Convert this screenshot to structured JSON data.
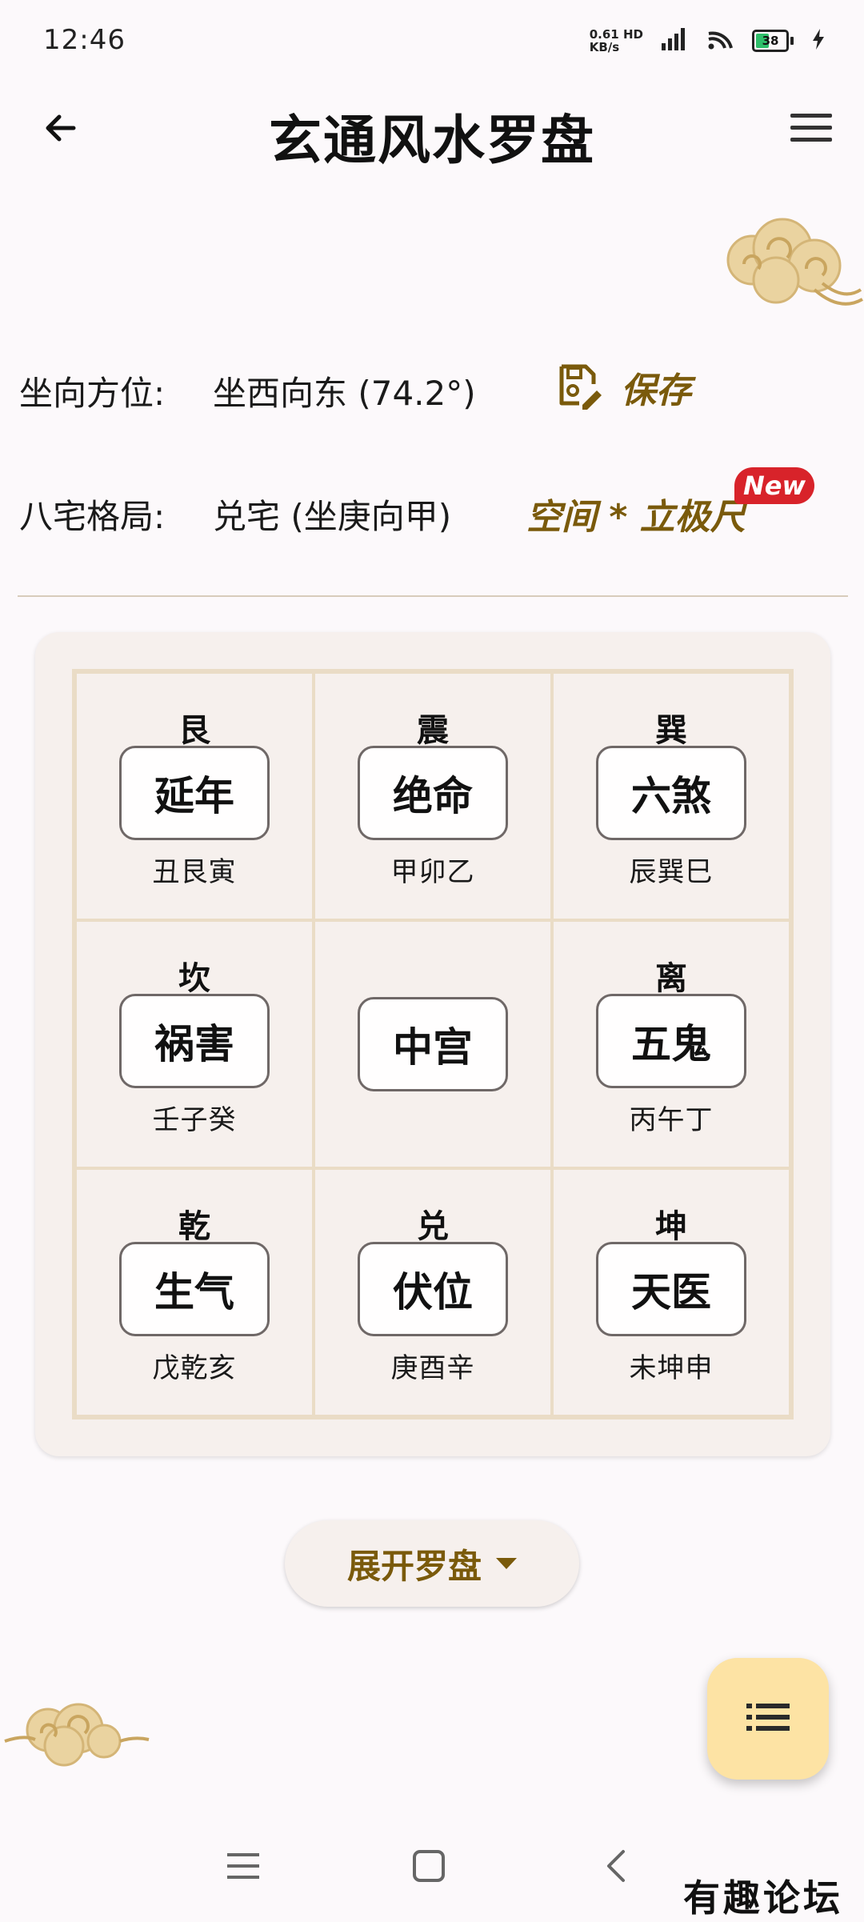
{
  "status_bar": {
    "time": "12:46",
    "net_speed_value": "0.61",
    "net_speed_unit": "KB/s",
    "net_type": "HD",
    "battery_level": "38",
    "icons": [
      "signal-icon",
      "wifi-icon",
      "battery-icon",
      "charging-icon"
    ]
  },
  "app_bar": {
    "title": "玄通风水罗盘",
    "back_icon": "arrow-left-icon",
    "menu_icon": "hamburger-menu-icon"
  },
  "orientation_row": {
    "label": "坐向方位:",
    "value": "坐西向东 (74.2°)",
    "save_label": "保存",
    "save_icon": "save-edit-icon"
  },
  "house_row": {
    "label": "八宅格局:",
    "value": "兑宅 (坐庚向甲)",
    "link_label": "空间 * 立极尺",
    "badge": "New"
  },
  "grid": {
    "cells": [
      {
        "trigram": "艮",
        "star": "延年",
        "mountains": "丑艮寅"
      },
      {
        "trigram": "震",
        "star": "绝命",
        "mountains": "甲卯乙"
      },
      {
        "trigram": "巽",
        "star": "六煞",
        "mountains": "辰巽巳"
      },
      {
        "trigram": "坎",
        "star": "祸害",
        "mountains": "壬子癸"
      },
      {
        "trigram": "",
        "star": "中宫",
        "mountains": ""
      },
      {
        "trigram": "离",
        "star": "五鬼",
        "mountains": "丙午丁"
      },
      {
        "trigram": "乾",
        "star": "生气",
        "mountains": "戊乾亥"
      },
      {
        "trigram": "兑",
        "star": "伏位",
        "mountains": "庚酉辛"
      },
      {
        "trigram": "坤",
        "star": "天医",
        "mountains": "未坤申"
      }
    ]
  },
  "expand_button": {
    "label": "展开罗盘",
    "icon": "caret-down-icon"
  },
  "fab": {
    "icon": "list-icon"
  },
  "nav_bar": {
    "items": [
      "recents-icon",
      "home-icon",
      "back-icon"
    ]
  },
  "watermark": "有趣论坛",
  "colors": {
    "accent": "#7a5a0b",
    "background": "#fcf9fb",
    "card": "#f6f0ed",
    "grid_line": "#eadcc6",
    "fab": "#fde3a4",
    "badge": "#d8232a",
    "cloud": "#e6c98a"
  }
}
